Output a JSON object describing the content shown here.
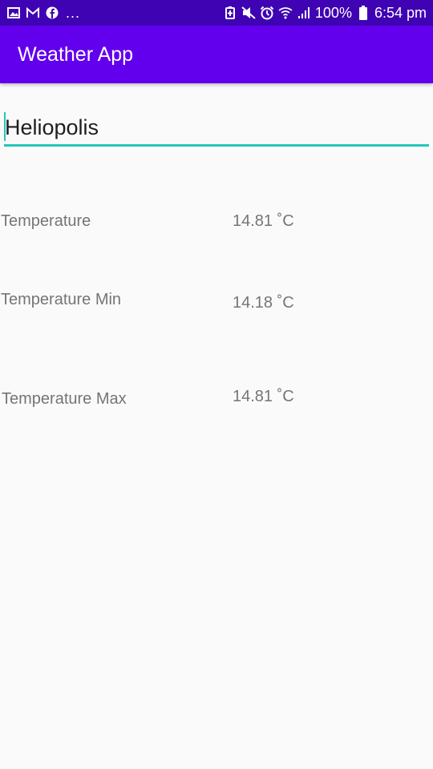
{
  "status_bar": {
    "icons_left": [
      "gallery-icon",
      "gmail-icon",
      "facebook-icon"
    ],
    "overflow": "...",
    "icons_right": [
      "battery-saver-icon",
      "mute-icon",
      "alarm-icon",
      "wifi-icon",
      "signal-icon",
      "battery-icon"
    ],
    "battery": "100%",
    "time": "6:54 pm"
  },
  "app_bar": {
    "title": "Weather App"
  },
  "city_input": {
    "value": "Heliopolis"
  },
  "weather": {
    "temperature": {
      "label": "Temperature",
      "value": "14.81 ˚C"
    },
    "temperature_min": {
      "label": "Temperature Min",
      "value": "14.18 ˚C"
    },
    "temperature_max": {
      "label": "Temperature Max",
      "value": "14.81 ˚C"
    }
  },
  "colors": {
    "status_bar": "#3f03b4",
    "app_bar": "#6200ee",
    "accent": "#26c6b9",
    "background": "#fafafa",
    "label_text": "#757575"
  }
}
